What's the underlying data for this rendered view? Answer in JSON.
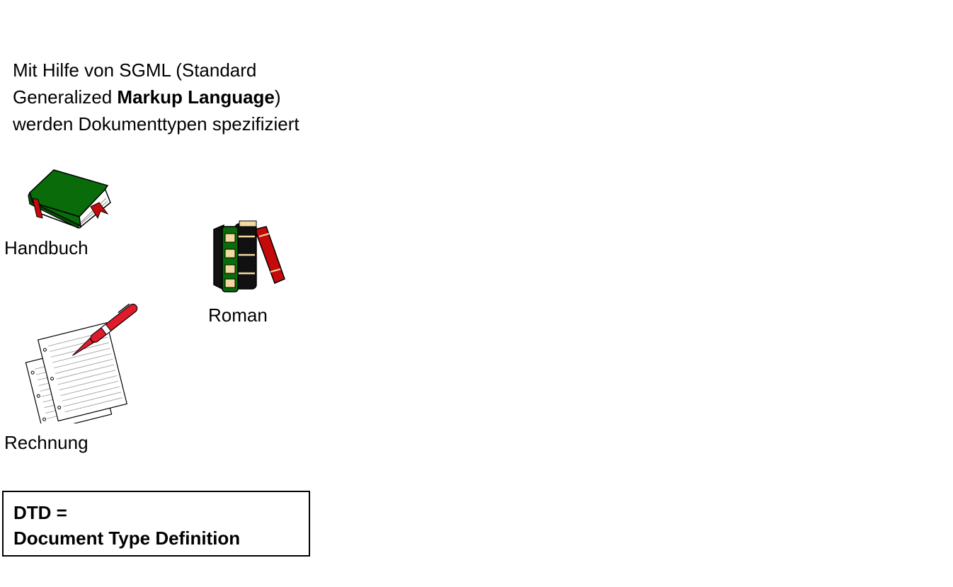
{
  "intro": {
    "line1": "Mit Hilfe von SGML (Standard",
    "line2_prefix": "Generalized ",
    "line2_bold": "Markup Language",
    "line2_suffix": ")",
    "line3": "werden Dokumenttypen spezifiziert"
  },
  "documents": {
    "handbuch": {
      "label": "Handbuch",
      "icon": "green-book-icon"
    },
    "roman": {
      "label": "Roman",
      "icon": "book-stack-icon"
    },
    "rechnung": {
      "label": "Rechnung",
      "icon": "papers-pen-icon"
    }
  },
  "dtd": {
    "line1": "DTD =",
    "line2": "Document Type Definition"
  },
  "colors": {
    "book_green": "#0a6b0a",
    "book_red": "#c40a0a",
    "pen_red": "#e01c2c",
    "page_bg": "#ffffff"
  }
}
